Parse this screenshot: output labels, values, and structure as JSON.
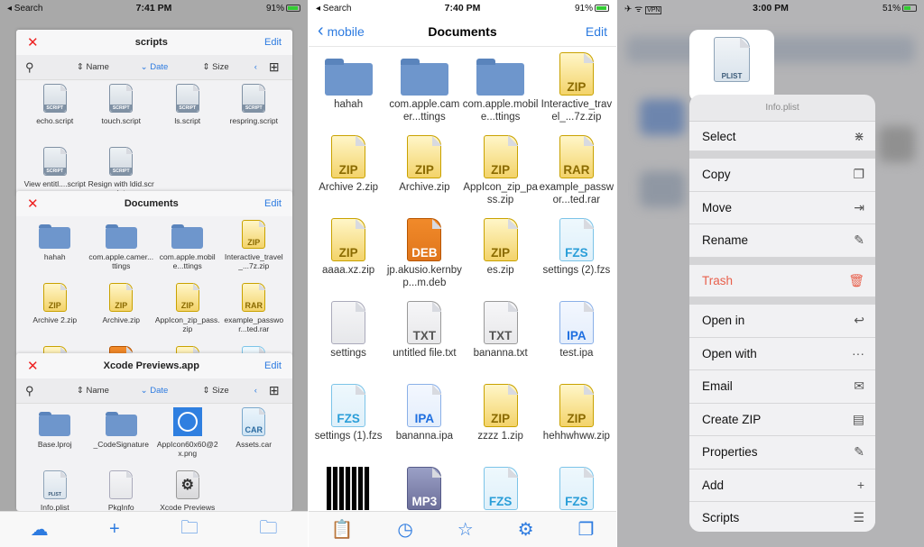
{
  "colors": {
    "accent": "#2d7be0",
    "close": "#e22222",
    "trash": "#e8604c"
  },
  "left": {
    "status": {
      "left": "◂ Search",
      "time": "7:41 PM",
      "battery": "91%",
      "vpn": "VPN"
    },
    "sort": {
      "name": "Name",
      "date": "Date",
      "size": "Size"
    },
    "cards": [
      {
        "title": "scripts",
        "edit": "Edit",
        "sort": true,
        "files": [
          [
            "script",
            "echo.script"
          ],
          [
            "script",
            "touch.script"
          ],
          [
            "script",
            "ls.script"
          ],
          [
            "script",
            "respring.script"
          ],
          [
            "script",
            "View entitl....script"
          ],
          [
            "script",
            "Resign with ldid.script"
          ]
        ]
      },
      {
        "title": "Documents",
        "edit": "Edit",
        "sort": false,
        "files": [
          [
            "folder",
            "hahah"
          ],
          [
            "folder",
            "com.apple.camer...ttings"
          ],
          [
            "folder",
            "com.apple.mobile...ttings"
          ],
          [
            "zip",
            "Interactive_travel_...7z.zip"
          ],
          [
            "zip",
            "Archive 2.zip"
          ],
          [
            "zip",
            "Archive.zip"
          ],
          [
            "zip",
            "AppIcon_zip_pass.zip"
          ],
          [
            "rar",
            "example_passwor...ted.rar"
          ],
          [
            "zip",
            ""
          ],
          [
            "deb",
            ""
          ],
          [
            "zip",
            ""
          ],
          [
            "fzs",
            ""
          ]
        ]
      },
      {
        "title": "Xcode Previews.app",
        "edit": "Edit",
        "sort": true,
        "files": [
          [
            "folder",
            "Base.lproj"
          ],
          [
            "folder",
            "_CodeSignature"
          ],
          [
            "appicon",
            "AppIcon60x60@2x.png"
          ],
          [
            "car",
            "Assets.car"
          ],
          [
            "plist",
            "Info.plist"
          ],
          [
            "plain",
            "PkgInfo"
          ],
          [
            "exec",
            "Xcode Previews"
          ]
        ]
      }
    ],
    "toolbar": [
      [
        "cloud-icon",
        "☁"
      ],
      [
        "add-icon",
        "+"
      ],
      [
        "folder-app-icon",
        "🗀"
      ],
      [
        "folder-music-icon",
        "🗀"
      ]
    ]
  },
  "middle": {
    "status": {
      "left": "◂ Search",
      "time": "7:40 PM",
      "battery": "91%",
      "vpn": "VPN"
    },
    "back": "mobile",
    "title": "Documents",
    "edit": "Edit",
    "files": [
      [
        "folder",
        "hahah"
      ],
      [
        "folder",
        "com.apple.camer...ttings"
      ],
      [
        "folder",
        "com.apple.mobile...ttings"
      ],
      [
        "zip",
        "Interactive_travel_...7z.zip"
      ],
      [
        "zip",
        "Archive 2.zip"
      ],
      [
        "zip",
        "Archive.zip"
      ],
      [
        "zip",
        "AppIcon_zip_pass.zip"
      ],
      [
        "rar",
        "example_passwor...ted.rar"
      ],
      [
        "zip",
        "aaaa.xz.zip"
      ],
      [
        "deb",
        "jp.akusio.kernbyp...m.deb"
      ],
      [
        "zip",
        "es.zip"
      ],
      [
        "fzs",
        "settings (2).fzs"
      ],
      [
        "plain",
        "settings"
      ],
      [
        "txt",
        "untitled file.txt"
      ],
      [
        "txt",
        "bananna.txt"
      ],
      [
        "ipa",
        "test.ipa"
      ],
      [
        "fzs",
        "settings (1).fzs"
      ],
      [
        "ipa",
        "bananna.ipa"
      ],
      [
        "zip",
        "zzzz 1.zip"
      ],
      [
        "zip",
        "hehhwhww.zip"
      ],
      [
        "img",
        ""
      ],
      [
        "mp3",
        ""
      ],
      [
        "fzs",
        ""
      ],
      [
        "fzs",
        ""
      ]
    ],
    "toolbar": [
      [
        "clipboard-icon",
        "📋"
      ],
      [
        "clock-icon",
        "◷"
      ],
      [
        "star-icon",
        "☆"
      ],
      [
        "gear-icon",
        "⚙"
      ],
      [
        "windows-icon",
        "❐"
      ]
    ]
  },
  "right": {
    "status": {
      "time": "3:00 PM",
      "battery": "51%",
      "vpn": "VPN"
    },
    "menu_title": "Info.plist",
    "groups": [
      [
        [
          "Select",
          "select-icon",
          "⋇"
        ]
      ],
      [
        [
          "Copy",
          "copy-icon",
          "❐"
        ],
        [
          "Move",
          "move-icon",
          "⇥"
        ],
        [
          "Rename",
          "rename-icon",
          "✎"
        ]
      ],
      [
        [
          "Trash",
          "trash-icon",
          "🗑"
        ]
      ],
      [
        [
          "Open in",
          "open-in-icon",
          "↩"
        ],
        [
          "Open with",
          "open-with-icon",
          "···"
        ],
        [
          "Email",
          "email-icon",
          "✉"
        ],
        [
          "Create ZIP",
          "create-zip-icon",
          "▤"
        ],
        [
          "Properties",
          "properties-icon",
          "✎"
        ],
        [
          "Add",
          "add-icon",
          "+"
        ],
        [
          "Scripts",
          "scripts-icon",
          "☰"
        ]
      ]
    ]
  }
}
